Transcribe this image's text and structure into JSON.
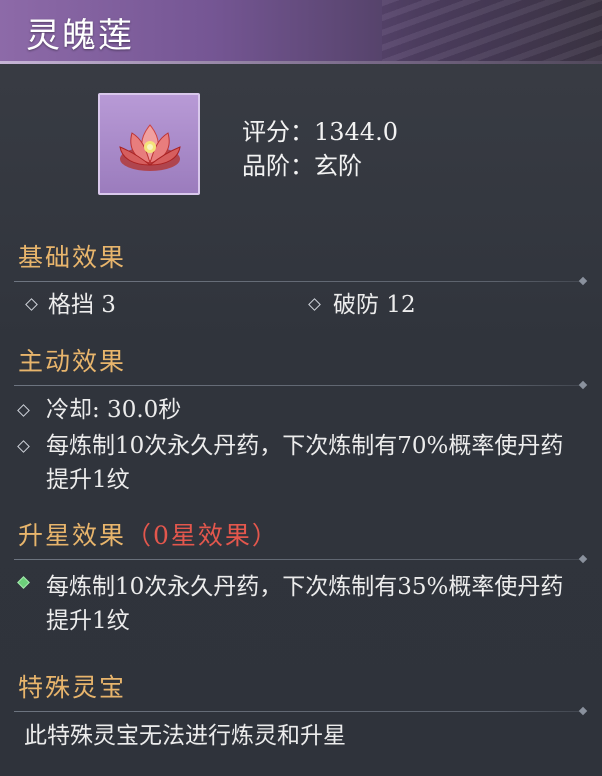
{
  "item": {
    "name": "灵魄莲",
    "icon": "lotus-icon",
    "score_label": "评分：",
    "score_value": "1344.0",
    "grade_label": "品阶：",
    "grade_value": "玄阶"
  },
  "base_effects": {
    "title": "基础效果",
    "items": [
      {
        "text": "格挡 3"
      },
      {
        "text": "破防 12"
      }
    ]
  },
  "active_effects": {
    "title": "主动效果",
    "items": [
      {
        "text": "冷却: 30.0秒"
      },
      {
        "text": "每炼制10次永久丹药，下次炼制有70%概率使丹药提升1纹"
      }
    ]
  },
  "star_effects": {
    "title": "升星效果",
    "subtitle": "（0星效果）",
    "items": [
      {
        "text": "每炼制10次永久丹药，下次炼制有35%概率使丹药提升1纹"
      }
    ]
  },
  "special": {
    "title": "特殊灵宝",
    "text": "此特殊灵宝无法进行炼灵和升星"
  },
  "colors": {
    "section_title": "#e8b56c",
    "star_subtitle": "#e3574d",
    "active_bullet": "#6cd07a",
    "title_bar": "#8d6aa8"
  }
}
